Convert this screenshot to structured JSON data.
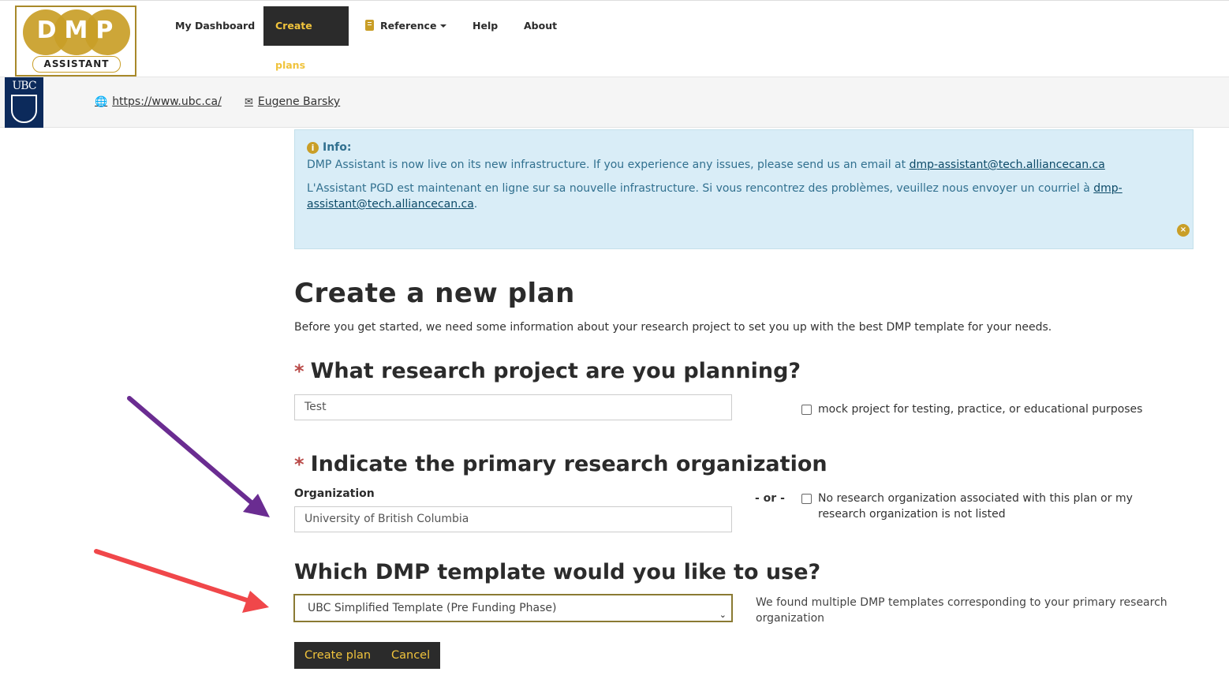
{
  "header": {
    "logo_main": "DMP",
    "logo_sub": "ASSISTANT",
    "nav": {
      "dashboard": "My Dashboard",
      "create": "Create plans",
      "reference": "Reference",
      "help": "Help",
      "about": "About"
    }
  },
  "org_bar": {
    "logo_text": "UBC",
    "website": "https://www.ubc.ca/",
    "contact": "Eugene Barsky"
  },
  "info": {
    "title": "Info:",
    "en_text": "DMP Assistant is now live on its new infrastructure. If you experience any issues, please send us an email at ",
    "en_email": "dmp-assistant@tech.alliancecan.ca",
    "fr_text": "L'Assistant PGD est maintenant en ligne sur sa nouvelle infrastructure. Si vous rencontrez des problèmes, veuillez nous envoyer un courriel à ",
    "fr_email": "dmp-assistant@tech.alliancecan.ca",
    "fr_end": "."
  },
  "page": {
    "title": "Create a new plan",
    "intro": "Before you get started, we need some information about your research project to set you up with the best DMP template for your needs."
  },
  "project": {
    "heading": "What research project are you planning?",
    "value": "Test",
    "mock_label": "mock project for testing, practice, or educational purposes"
  },
  "organization": {
    "heading": "Indicate the primary research organization",
    "label": "Organization",
    "value": "University of British Columbia",
    "or_text": "- or -",
    "none_label": "No research organization associated with this plan or my research organization is not listed"
  },
  "template": {
    "heading": "Which DMP template would you like to use?",
    "selected": "UBC Simplified Template (Pre Funding Phase)",
    "hint": "We found multiple DMP templates corresponding to your primary research organization"
  },
  "actions": {
    "create": "Create plan",
    "cancel": "Cancel"
  },
  "colors": {
    "accent": "#c99e27",
    "nav_active_bg": "#2b2b2b",
    "nav_active_text": "#f0c33c",
    "info_bg": "#d9edf7",
    "required": "#b94a48",
    "arrow_purple": "#6a2c91",
    "arrow_red": "#f0474a"
  }
}
